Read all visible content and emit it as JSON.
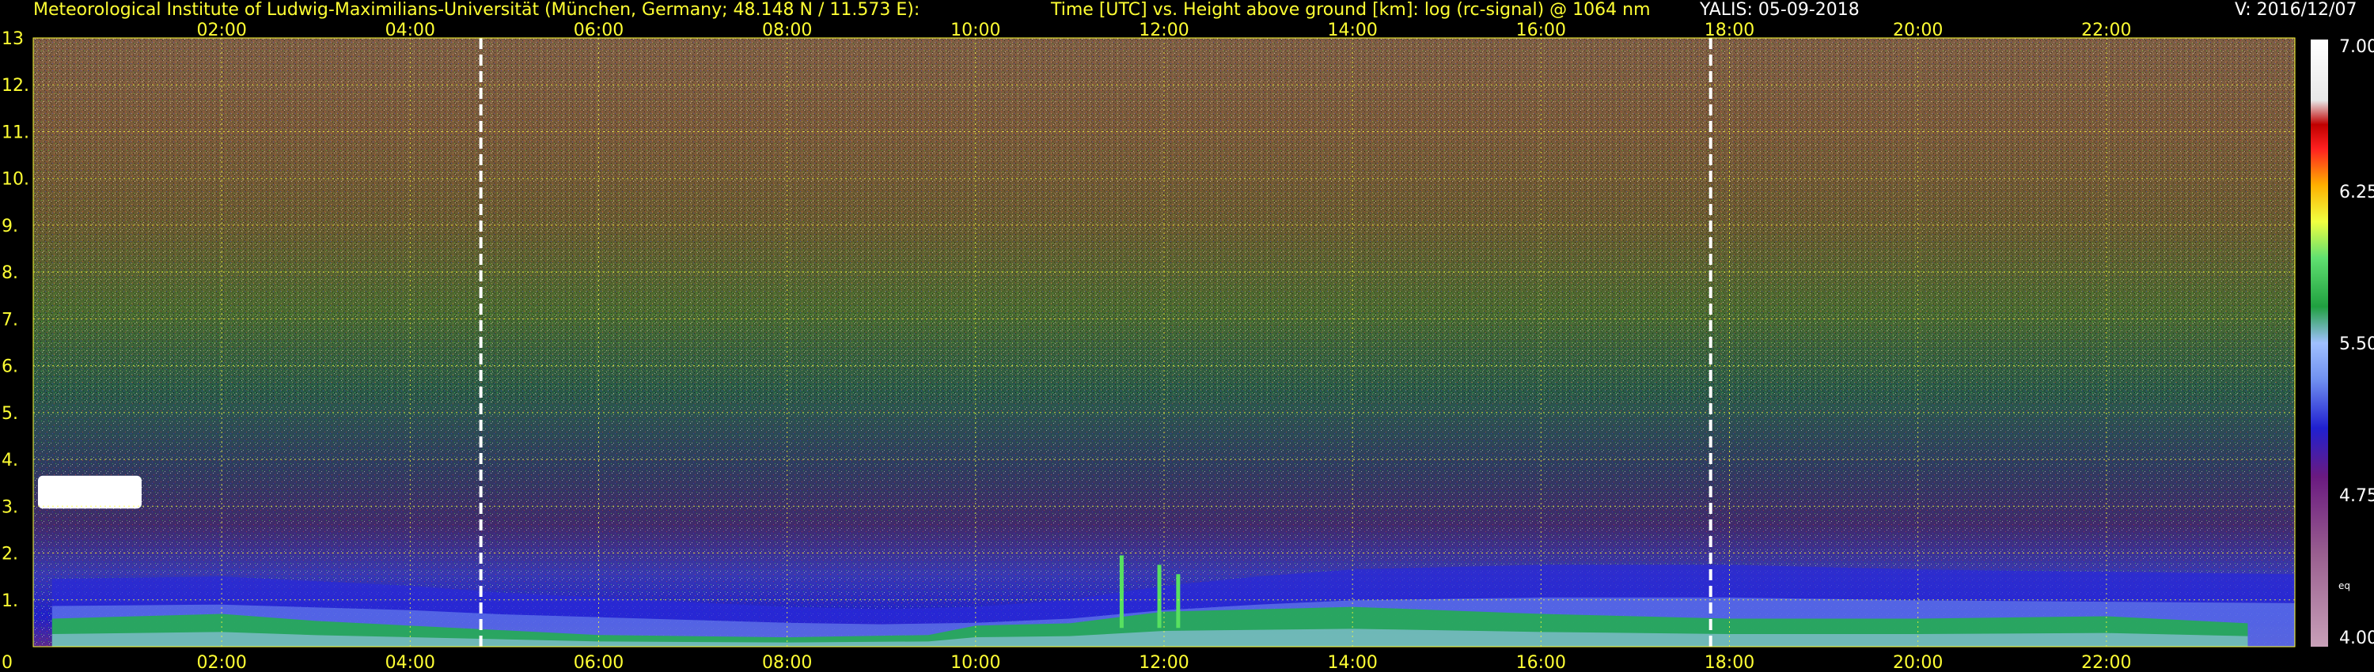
{
  "header": {
    "institute": "Meteorological Institute of Ludwig-Maximilians-Universität (München, Germany; 48.148 N / 11.573 E):",
    "axes_title": "Time [UTC] vs. Height above ground [km]: log (rc-signal) @ 1064 nm",
    "station_date": "YALIS: 05-09-2018",
    "version": "V: 2016/12/07"
  },
  "chart_data": {
    "type": "heatmap",
    "title": "Time [UTC] vs. Height above ground [km]: log (rc-signal) @ 1064 nm",
    "xlabel": "Time [UTC]",
    "ylabel": "Height above ground [km]",
    "xlim": [
      0,
      24
    ],
    "ylim": [
      0,
      13
    ],
    "x_ticks": [
      "02:00",
      "04:00",
      "06:00",
      "08:00",
      "10:00",
      "12:00",
      "14:00",
      "16:00",
      "18:00",
      "20:00",
      "22:00"
    ],
    "y_ticks": [
      "0",
      "1.",
      "2.",
      "3.",
      "4.",
      "5.",
      "6.",
      "7.",
      "8.",
      "9.",
      "10.",
      "11.",
      "12.",
      "13"
    ],
    "grid": true,
    "sunrise_sunset_lines_utc": [
      4.75,
      17.8
    ],
    "colorbar": {
      "range": [
        4.0,
        7.0
      ],
      "labels": [
        "7.00",
        "6.25",
        "5.50",
        "4.75",
        "4.00"
      ],
      "note": "eq"
    },
    "boundary_layer_top_km": [
      [
        0.2,
        1.45
      ],
      [
        2,
        1.5
      ],
      [
        4,
        1.3
      ],
      [
        5,
        1.15
      ],
      [
        6,
        1.05
      ],
      [
        7,
        0.95
      ],
      [
        8,
        0.85
      ],
      [
        9,
        0.8
      ],
      [
        10,
        0.85
      ],
      [
        11,
        1.0
      ],
      [
        12,
        1.3
      ],
      [
        13,
        1.5
      ],
      [
        14,
        1.65
      ],
      [
        16,
        1.75
      ],
      [
        18,
        1.75
      ],
      [
        20,
        1.65
      ],
      [
        22,
        1.6
      ],
      [
        24,
        1.55
      ]
    ],
    "aerosol_layer_top_km": [
      [
        0.2,
        0.6
      ],
      [
        2,
        0.7
      ],
      [
        3,
        0.55
      ],
      [
        4,
        0.45
      ],
      [
        6,
        0.25
      ],
      [
        8,
        0.2
      ],
      [
        9.5,
        0.25
      ],
      [
        10,
        0.45
      ],
      [
        11,
        0.5
      ],
      [
        12,
        0.75
      ],
      [
        14,
        0.85
      ],
      [
        16,
        0.7
      ],
      [
        18,
        0.6
      ],
      [
        20,
        0.6
      ],
      [
        22,
        0.65
      ],
      [
        23.5,
        0.5
      ]
    ],
    "cloud_features": [
      {
        "kind": "cloud",
        "t_start": 0.05,
        "t_end": 1.15,
        "h_bottom": 2.95,
        "h_top": 3.65
      },
      {
        "kind": "spike",
        "t": 11.55,
        "h_bottom": 0.4,
        "h_top": 1.95
      },
      {
        "kind": "spike",
        "t": 11.95,
        "h_bottom": 0.4,
        "h_top": 1.75
      },
      {
        "kind": "spike",
        "t": 12.15,
        "h_bottom": 0.4,
        "h_top": 1.55
      }
    ]
  }
}
